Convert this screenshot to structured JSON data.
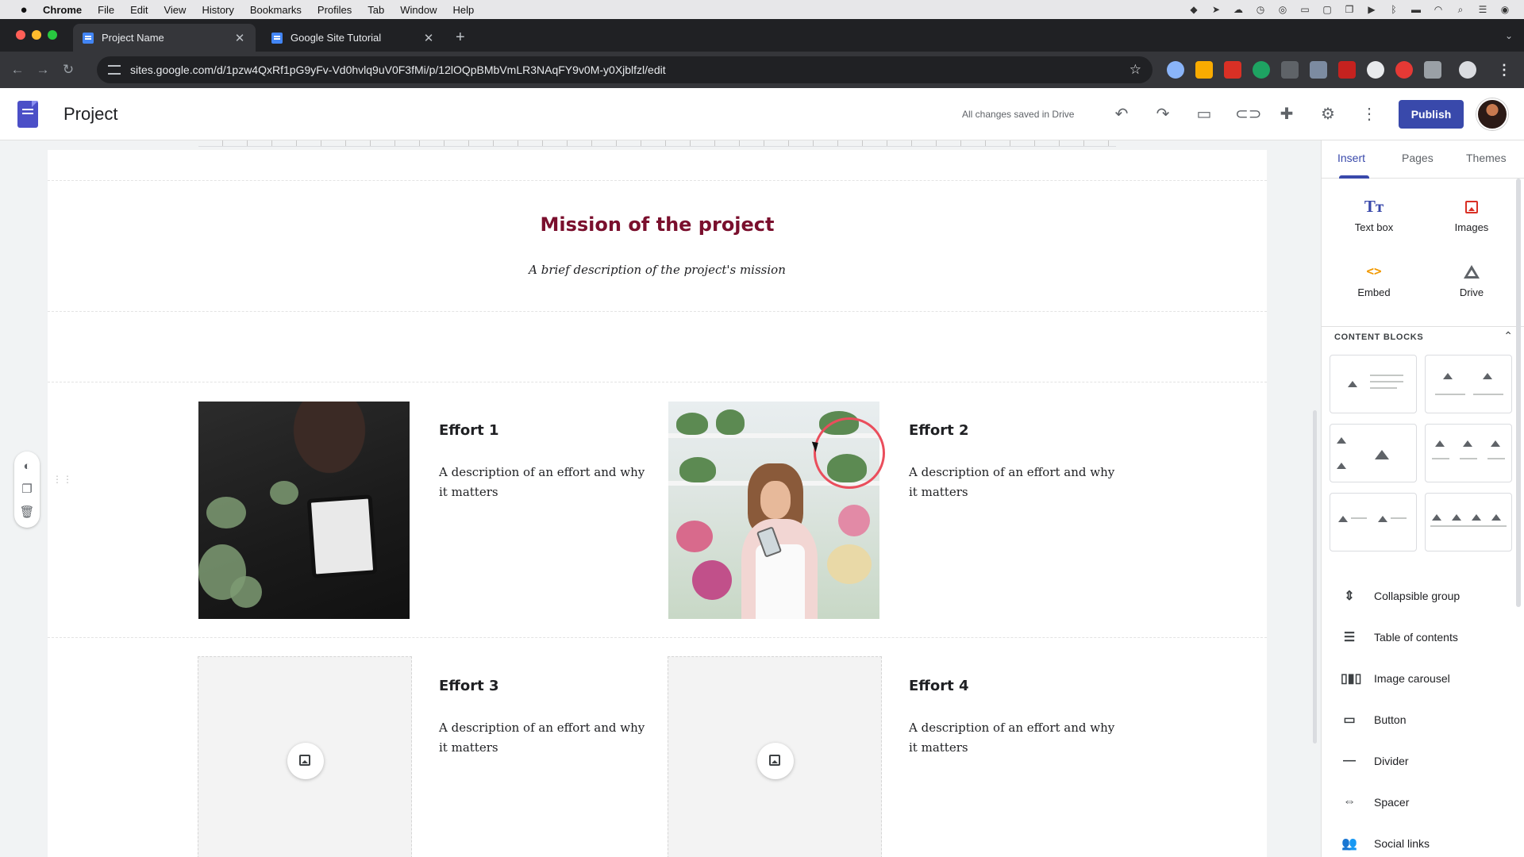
{
  "mac_menu": {
    "apple": "",
    "items": [
      "Chrome",
      "File",
      "Edit",
      "View",
      "History",
      "Bookmarks",
      "Profiles",
      "Tab",
      "Window",
      "Help"
    ]
  },
  "browser": {
    "tabs": [
      {
        "title": "Project Name",
        "active": true
      },
      {
        "title": "Google Site Tutorial",
        "active": false
      }
    ],
    "url": "sites.google.com/d/1pzw4QxRf1pG9yFv-Vd0hvlq9uV0F3fMi/p/12lOQpBMbVmLR3NAqFY9v0M-y0Xjblfzl/edit"
  },
  "sites_header": {
    "title": "Project",
    "save_status": "All changes saved in Drive",
    "publish_label": "Publish"
  },
  "page": {
    "mission_title": "Mission of the project",
    "mission_desc": "A brief description of the project's mission",
    "efforts": [
      {
        "title": "Effort 1",
        "desc": "A description of an effort and why it matters"
      },
      {
        "title": "Effort 2",
        "desc": "A description of an effort and why it matters"
      },
      {
        "title": "Effort 3",
        "desc": "A description of an effort and why it matters"
      },
      {
        "title": "Effort 4",
        "desc": "A description of an effort and why it matters"
      }
    ]
  },
  "panel": {
    "tabs": [
      "Insert",
      "Pages",
      "Themes"
    ],
    "active_tab": "Insert",
    "insert_items": [
      {
        "label": "Text box",
        "icon": "text-box-icon"
      },
      {
        "label": "Images",
        "icon": "image-icon"
      },
      {
        "label": "Embed",
        "icon": "embed-icon"
      },
      {
        "label": "Drive",
        "icon": "drive-icon"
      }
    ],
    "content_blocks_label": "CONTENT BLOCKS",
    "list": [
      {
        "label": "Collapsible group",
        "icon": "collapsible-icon"
      },
      {
        "label": "Table of contents",
        "icon": "toc-icon"
      },
      {
        "label": "Image carousel",
        "icon": "carousel-icon"
      },
      {
        "label": "Button",
        "icon": "button-icon"
      },
      {
        "label": "Divider",
        "icon": "divider-icon"
      },
      {
        "label": "Spacer",
        "icon": "spacer-icon"
      },
      {
        "label": "Social links",
        "icon": "social-icon"
      }
    ]
  },
  "colors": {
    "accent": "#3949ab",
    "mission_title": "#7a0f2d",
    "cursor_ring": "#ea4e5c"
  }
}
